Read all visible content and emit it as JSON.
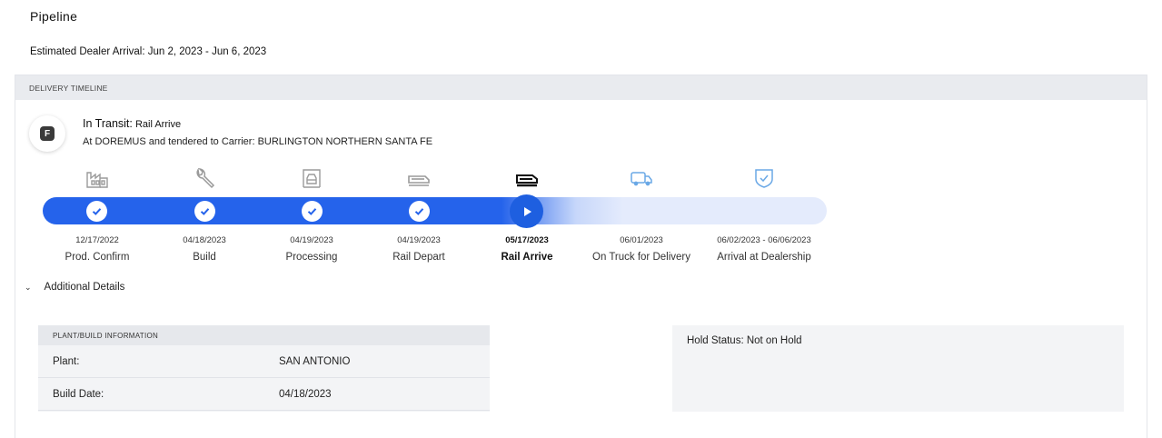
{
  "page": {
    "title": "Pipeline",
    "eta_label": "Estimated Dealer Arrival: Jun 2, 2023 - Jun 6, 2023"
  },
  "timeline": {
    "header": "DELIVERY TIMELINE",
    "badge_letter": "F",
    "status_main": "In Transit:",
    "status_sub": " Rail Arrive",
    "status_detail": "At DOREMUS and tendered to Carrier: BURLINGTON NORTHERN SANTA FE",
    "progress_completed_steps": 4,
    "progress_current_step": 5,
    "steps": [
      {
        "date": "12/17/2022",
        "label": "Prod. Confirm",
        "state": "done",
        "icon": "factory-icon"
      },
      {
        "date": "04/18/2023",
        "label": "Build",
        "state": "done",
        "icon": "wrench-icon"
      },
      {
        "date": "04/19/2023",
        "label": "Processing",
        "state": "done",
        "icon": "vehicle-processing-icon"
      },
      {
        "date": "04/19/2023",
        "label": "Rail Depart",
        "state": "done",
        "icon": "rail-car-icon"
      },
      {
        "date": "05/17/2023",
        "label": "Rail Arrive",
        "state": "current",
        "icon": "rail-car-icon"
      },
      {
        "date": "06/01/2023",
        "label": "On Truck for Delivery",
        "state": "upcoming",
        "icon": "truck-icon"
      },
      {
        "date": "06/02/2023 - 06/06/2023",
        "label": "Arrival at Dealership",
        "state": "upcoming",
        "icon": "shield-check-icon"
      }
    ],
    "colors": {
      "accent": "#2563eb",
      "track_light": "#e4ebfc",
      "upcoming_icon": "#6aa8e6",
      "done_icon": "#9a9a9a"
    }
  },
  "details": {
    "toggle_label": "Additional Details",
    "plant_header": "PLANT/BUILD INFORMATION",
    "rows": [
      {
        "key": "Plant:",
        "value": "SAN ANTONIO"
      },
      {
        "key": "Build Date:",
        "value": "04/18/2023"
      }
    ],
    "hold_status": "Hold Status: Not on Hold"
  }
}
